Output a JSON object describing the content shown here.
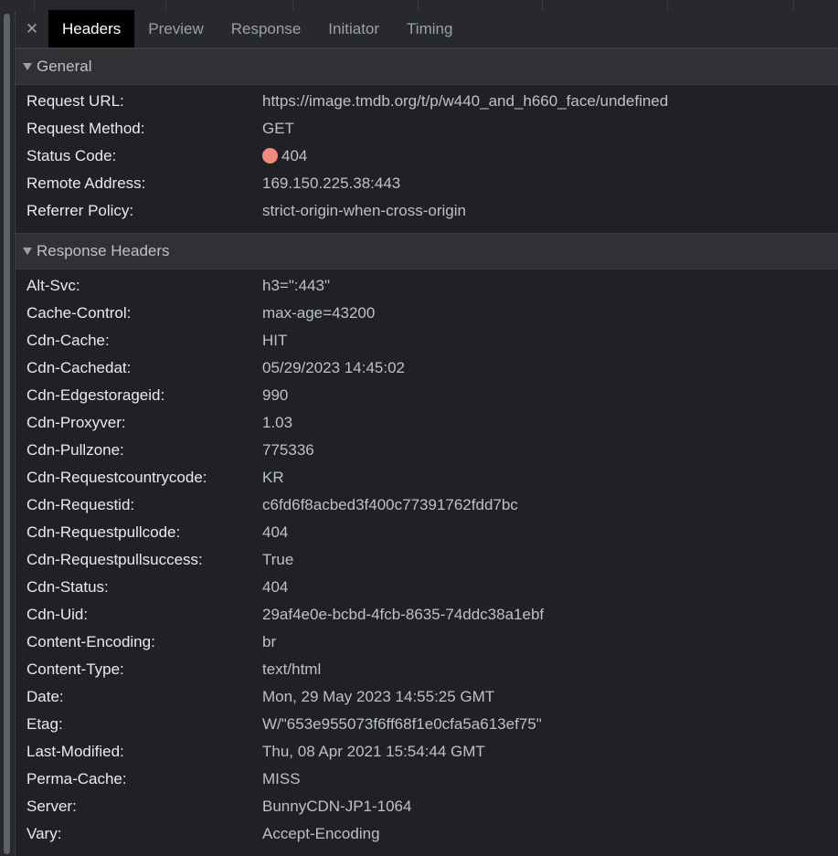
{
  "tabs": {
    "close_label": "✕",
    "items": [
      {
        "label": "Headers"
      },
      {
        "label": "Preview"
      },
      {
        "label": "Response"
      },
      {
        "label": "Initiator"
      },
      {
        "label": "Timing"
      }
    ]
  },
  "general": {
    "title": "General",
    "rows": [
      {
        "key": "Request URL:",
        "value": "https://image.tmdb.org/t/p/w440_and_h660_face/undefined"
      },
      {
        "key": "Request Method:",
        "value": "GET"
      },
      {
        "key": "Status Code:",
        "value": "404"
      },
      {
        "key": "Remote Address:",
        "value": "169.150.225.38:443"
      },
      {
        "key": "Referrer Policy:",
        "value": "strict-origin-when-cross-origin"
      }
    ],
    "status_color": "#ee8a7e"
  },
  "response_headers": {
    "title": "Response Headers",
    "rows": [
      {
        "key": "Alt-Svc:",
        "value": "h3=\":443\""
      },
      {
        "key": "Cache-Control:",
        "value": "max-age=43200"
      },
      {
        "key": "Cdn-Cache:",
        "value": "HIT"
      },
      {
        "key": "Cdn-Cachedat:",
        "value": "05/29/2023 14:45:02"
      },
      {
        "key": "Cdn-Edgestorageid:",
        "value": "990"
      },
      {
        "key": "Cdn-Proxyver:",
        "value": "1.03"
      },
      {
        "key": "Cdn-Pullzone:",
        "value": "775336"
      },
      {
        "key": "Cdn-Requestcountrycode:",
        "value": "KR"
      },
      {
        "key": "Cdn-Requestid:",
        "value": "c6fd6f8acbed3f400c77391762fdd7bc"
      },
      {
        "key": "Cdn-Requestpullcode:",
        "value": "404"
      },
      {
        "key": "Cdn-Requestpullsuccess:",
        "value": "True"
      },
      {
        "key": "Cdn-Status:",
        "value": "404"
      },
      {
        "key": "Cdn-Uid:",
        "value": "29af4e0e-bcbd-4fcb-8635-74ddc38a1ebf"
      },
      {
        "key": "Content-Encoding:",
        "value": "br"
      },
      {
        "key": "Content-Type:",
        "value": "text/html"
      },
      {
        "key": "Date:",
        "value": "Mon, 29 May 2023 14:55:25 GMT"
      },
      {
        "key": "Etag:",
        "value": "W/\"653e955073f6ff68f1e0cfa5a613ef75\""
      },
      {
        "key": "Last-Modified:",
        "value": "Thu, 08 Apr 2021 15:54:44 GMT"
      },
      {
        "key": "Perma-Cache:",
        "value": "MISS"
      },
      {
        "key": "Server:",
        "value": "BunnyCDN-JP1-1064"
      },
      {
        "key": "Vary:",
        "value": "Accept-Encoding"
      }
    ]
  }
}
